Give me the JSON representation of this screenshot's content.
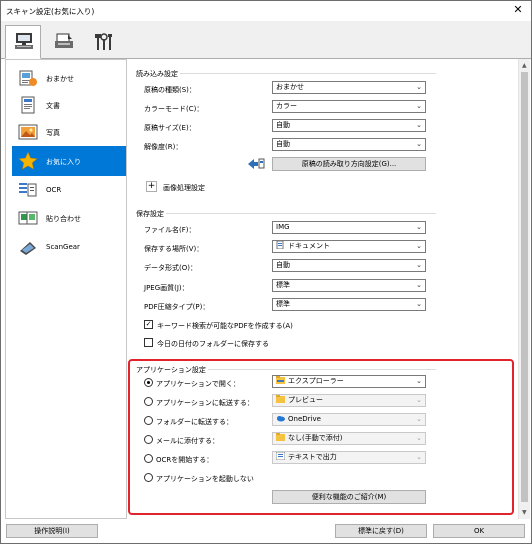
{
  "window": {
    "title": "スキャン設定(お気に入り)",
    "close": "✕"
  },
  "tabs": [
    {
      "icon": "scan-from-computer-icon",
      "active": true
    },
    {
      "icon": "scan-from-panel-icon",
      "active": false
    },
    {
      "icon": "tools-icon",
      "active": false
    }
  ],
  "sidebar": {
    "items": [
      {
        "label": "おまかせ",
        "icon": "auto-scan-icon"
      },
      {
        "label": "文書",
        "icon": "document-icon"
      },
      {
        "label": "写真",
        "icon": "photo-icon"
      },
      {
        "label": "お気に入り",
        "icon": "star-icon",
        "selected": true
      },
      {
        "label": "OCR",
        "icon": "ocr-icon"
      },
      {
        "label": "貼り合わせ",
        "icon": "stitch-icon"
      },
      {
        "label": "ScanGear",
        "icon": "scangear-icon"
      }
    ]
  },
  "scan_options": {
    "header": "読み込み設定",
    "source_label": "原稿の種類(S)：",
    "source_value": "おまかせ",
    "color_label": "カラーモード(C)：",
    "color_value": "カラー",
    "size_label": "原稿サイズ(E)：",
    "size_value": "自動",
    "resolution_label": "解像度(R)：",
    "resolution_value": "自動",
    "orientation_button": "原稿の読み取り方向設定(G)...",
    "image_processing_label": "画像処理設定",
    "plus": "+"
  },
  "save_settings": {
    "header": "保存設定",
    "filename_label": "ファイル名(F)：",
    "filename_value": "IMG",
    "save_in_label": "保存する場所(V)：",
    "save_in_value": "ドキュメント",
    "format_label": "データ形式(O)：",
    "format_value": "自動",
    "jpeg_label": "JPEG画質(J)：",
    "jpeg_value": "標準",
    "pdf_label": "PDF圧縮タイプ(P)：",
    "pdf_value": "標準",
    "keyword_pdf_label": "キーワード検索が可能なPDFを作成する(A)",
    "keyword_pdf_checked": true,
    "date_folder_label": "今日の日付のフォルダーに保存する",
    "date_folder_checked": false,
    "check_mark": "✓"
  },
  "app_settings": {
    "header": "アプリケーション設定",
    "options": [
      {
        "label": "アプリケーションで開く：",
        "value": "エクスプローラー",
        "selected": true,
        "disabled": false,
        "icon": "explorer-icon"
      },
      {
        "label": "アプリケーションに転送する：",
        "value": "プレビュー",
        "selected": false,
        "disabled": true,
        "icon": "preview-icon"
      },
      {
        "label": "フォルダーに転送する：",
        "value": "OneDrive",
        "selected": false,
        "disabled": true,
        "icon": "onedrive-icon"
      },
      {
        "label": "メールに添付する：",
        "value": "なし(手動で添付)",
        "selected": false,
        "disabled": true,
        "icon": "mail-folder-icon"
      },
      {
        "label": "OCRを開始する：",
        "value": "テキストで出力",
        "selected": false,
        "disabled": true,
        "icon": "text-output-icon"
      },
      {
        "label": "アプリケーションを起動しない",
        "value": "",
        "selected": false,
        "disabled": false
      }
    ],
    "more_functions_button": "便利な機能のご紹介(M)"
  },
  "footer": {
    "instructions_button": "操作説明(I)",
    "defaults_button": "標準に戻す(D)",
    "ok_button": "OK"
  },
  "colors": {
    "selection": "#0078d7",
    "highlight_border": "#e1242b",
    "star": "#f5b400"
  }
}
